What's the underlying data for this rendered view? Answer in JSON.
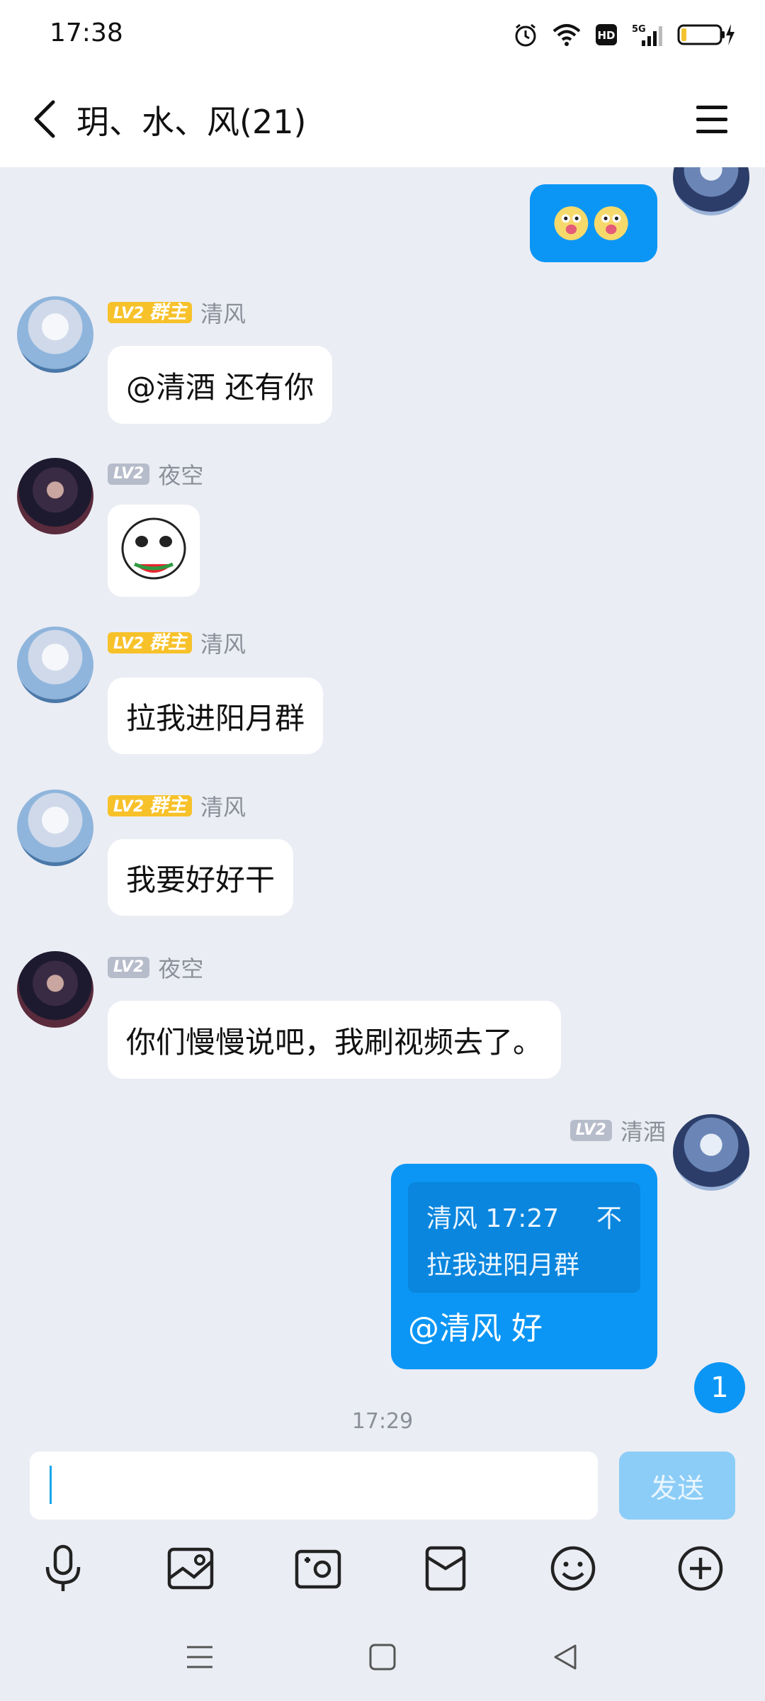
{
  "status_bar": {
    "time": "17:38",
    "network": "5G",
    "hd": "HD"
  },
  "header": {
    "title": "玥、水、风(21)"
  },
  "messages": [
    {
      "sender": "清风",
      "level": "LV2",
      "role": "群主",
      "text": "@清酒 还有你"
    },
    {
      "sender": "夜空",
      "level": "LV2",
      "sticker": "sticker-face"
    },
    {
      "sender": "清风",
      "level": "LV2",
      "role": "群主",
      "text": "拉我进阳月群"
    },
    {
      "sender": "清风",
      "level": "LV2",
      "role": "群主",
      "text": "我要好好干"
    },
    {
      "sender": "夜空",
      "level": "LV2",
      "text": "你们慢慢说吧，我刷视频去了。"
    },
    {
      "sender": "清酒",
      "level": "LV2",
      "reply": {
        "header": "清风 17:27",
        "action": "不",
        "quote": "拉我进阳月群"
      },
      "text": "@清风 好"
    }
  ],
  "unread_badge": "1",
  "timestamp": "17:29",
  "input": {
    "placeholder": "",
    "send_label": "发送"
  },
  "toolbar_icons": [
    "microphone-icon",
    "image-icon",
    "camera-icon",
    "red-packet-icon",
    "emoji-icon",
    "plus-icon"
  ],
  "colors": {
    "accent": "#0b96f5",
    "send_disabled": "#8ccdf7",
    "owner_badge": "#f7c12a",
    "level_badge": "#b6bcca"
  }
}
